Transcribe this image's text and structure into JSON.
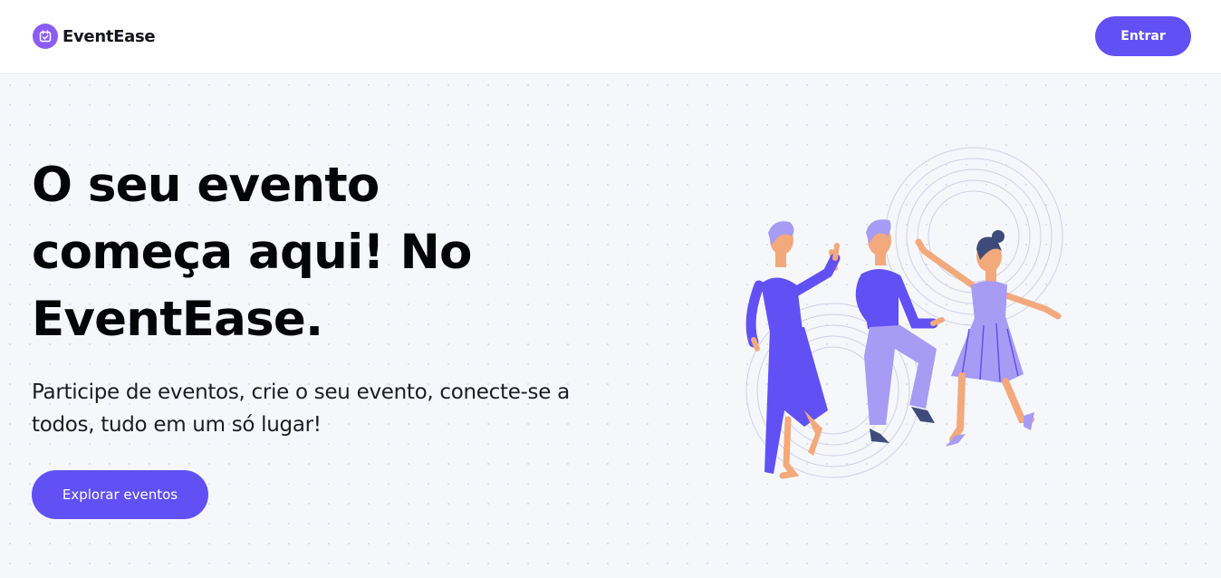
{
  "header": {
    "brand": "EventEase",
    "login_label": "Entrar"
  },
  "hero": {
    "title": "O seu evento começa aqui! No EventEase.",
    "subtitle": "Participe de eventos, crie o seu evento, conecte-se a todos, tudo em um só lugar!",
    "cta_label": "Explorar eventos"
  },
  "icons": {
    "logo": "calendar-check-icon"
  },
  "colors": {
    "accent": "#6150f4",
    "logo_bg": "#8b5cf6",
    "hero_bg": "#f6f7fb"
  }
}
